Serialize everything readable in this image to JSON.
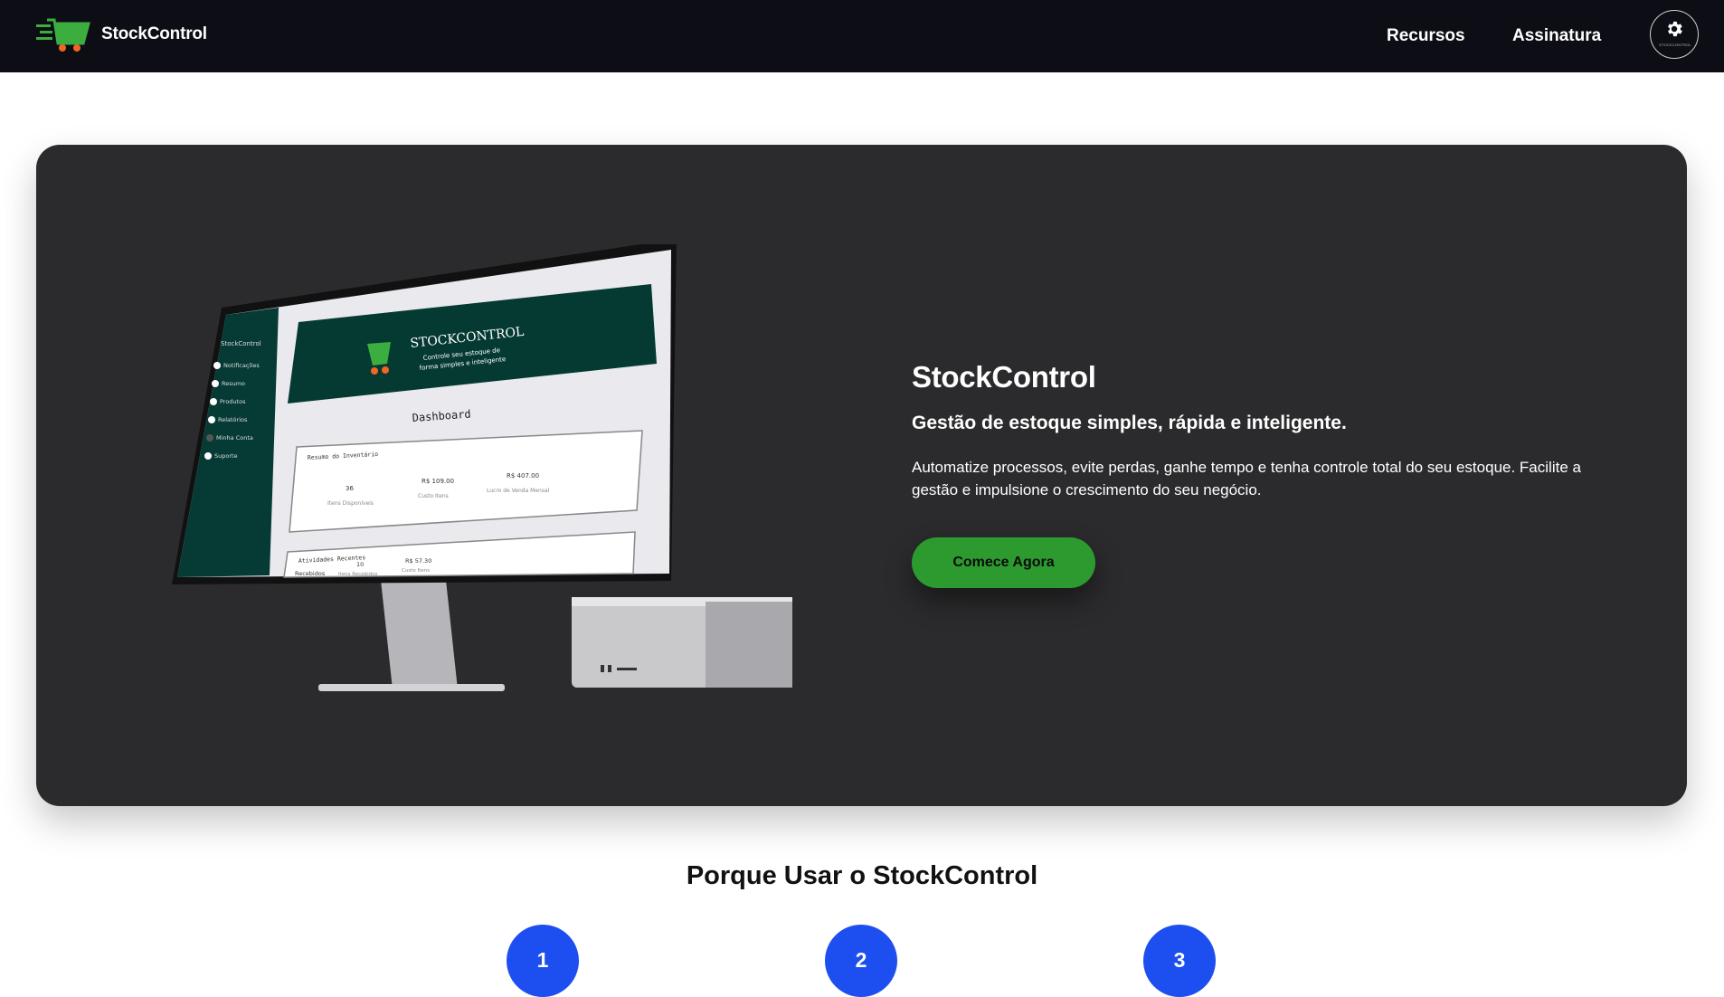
{
  "header": {
    "logo_icon": "shopping-cart-icon",
    "brand_name": "StockControl",
    "nav": [
      {
        "label": "Recursos"
      },
      {
        "label": "Assinatura"
      }
    ],
    "settings": {
      "icon": "gear-icon",
      "caption": "STOCKCONTROL"
    }
  },
  "hero": {
    "title": "StockControl",
    "subtitle": "Gestão de estoque simples, rápida e inteligente.",
    "description": "Automatize processos, evite perdas, ganhe tempo e tenha controle total do seu estoque. Facilite a gestão e impulsione o crescimento do seu negócio.",
    "cta_label": "Comece Agora",
    "colors": {
      "background": "#2b2b2d",
      "cta": "#2c9a2f"
    },
    "mockup": {
      "sidebar_brand": "StockControl",
      "sidebar_items": [
        "Notificações",
        "Resumo",
        "Produtos",
        "Relatórios",
        "Minha Conta",
        "Suporte"
      ],
      "banner_title": "STOCKCONTROL",
      "banner_line1": "Controle seu estoque de",
      "banner_line2": "forma simples e inteligente",
      "page_title": "Dashboard",
      "summary_title": "Resumo do Inventário",
      "summary_stats": [
        {
          "value": "36",
          "label": "Itens Disponíveis"
        },
        {
          "value": "R$ 109.00",
          "label": "Custo Itens"
        },
        {
          "value": "R$ 407.00",
          "label": "Lucro de Venda Mensal"
        }
      ],
      "recent_title": "Atividades Recentes",
      "recent_row": {
        "label": "Recebidos",
        "value1": "10",
        "caption1": "Itens Recebidos",
        "value2": "R$ 57.30",
        "caption2": "Custo Itens"
      }
    }
  },
  "why_section": {
    "title": "Porque Usar o StockControl",
    "steps": [
      "1",
      "2",
      "3"
    ],
    "step_color": "#1d4ff0"
  }
}
